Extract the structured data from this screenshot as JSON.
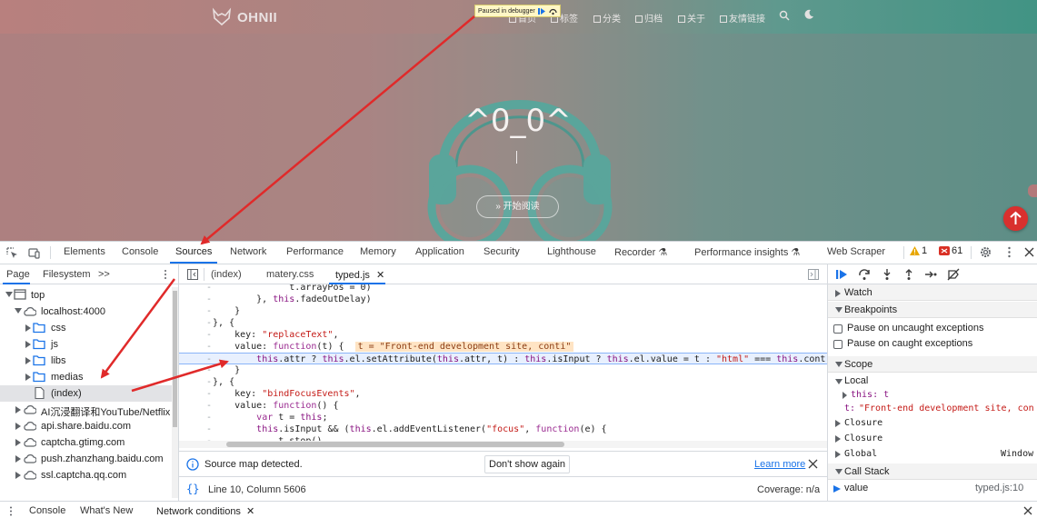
{
  "site": {
    "name": "OHNII",
    "nav": [
      "首页",
      "标签",
      "分类",
      "归档",
      "关于",
      "友情链接"
    ],
    "debugger_badge": "Paused in debugger",
    "hero_title": "^0_0^",
    "hero_button": "开始阅读"
  },
  "devtools": {
    "tabs": [
      "Elements",
      "Console",
      "Sources",
      "Network",
      "Performance",
      "Memory",
      "Application",
      "Security",
      "Lighthouse",
      "Recorder",
      "Performance insights",
      "Web Scraper"
    ],
    "active_tab": "Sources",
    "warnings": "1",
    "errors": "61"
  },
  "navigator": {
    "tabs": [
      "Page",
      "Filesystem",
      ">>"
    ],
    "tree": [
      {
        "label": "top"
      },
      {
        "label": "localhost:4000"
      },
      {
        "label": "css"
      },
      {
        "label": "js"
      },
      {
        "label": "libs"
      },
      {
        "label": "medias"
      },
      {
        "label": "(index)"
      },
      {
        "label": "AI沉浸翻译和YouTube/Netflix"
      },
      {
        "label": "api.share.baidu.com"
      },
      {
        "label": "captcha.gtimg.com"
      },
      {
        "label": "push.zhanzhang.baidu.com"
      },
      {
        "label": "ssl.captcha.qq.com"
      }
    ]
  },
  "editor": {
    "tabs": [
      "(index)",
      "matery.css",
      "typed.js"
    ],
    "source_map": {
      "message": "Source map detected.",
      "dont_show": "Don't show again",
      "learn_more": "Learn more"
    },
    "status": {
      "bracket": "{}",
      "position": "Line 10, Column 5606",
      "coverage": "Coverage: n/a"
    },
    "inline_value": "t = \"Front-end development site, conti\""
  },
  "debugger": {
    "sections": {
      "watch": "Watch",
      "breakpoints": "Breakpoints",
      "pause_uncaught": "Pause on uncaught exceptions",
      "pause_caught": "Pause on caught exceptions",
      "scope": "Scope",
      "local": "Local",
      "this_var": "this: t",
      "t_var_name": "t:",
      "t_var_value": "\"Front-end development site, con",
      "closure1": "Closure",
      "closure2": "Closure",
      "global": "Global",
      "global_value": "Window",
      "call_stack": "Call Stack",
      "frame_name": "value",
      "frame_loc": "typed.js:10"
    }
  },
  "drawer": {
    "tabs": [
      "Console",
      "What's New",
      "Network conditions"
    ]
  }
}
